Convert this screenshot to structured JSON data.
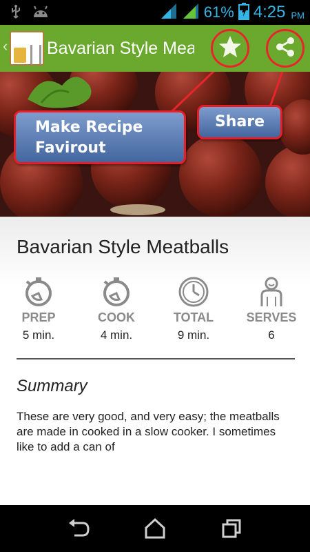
{
  "status_bar": {
    "battery_percent": "61%",
    "time": "4:25",
    "ampm": "PM",
    "icons": [
      "usb-icon",
      "android-icon",
      "signal-icon",
      "signal-icon",
      "battery-icon"
    ]
  },
  "action_bar": {
    "title": "Bavarian Style Meatballs",
    "favourite_icon": "star-icon",
    "share_icon": "share-icon"
  },
  "callouts": {
    "favourite_line1": "Make Recipe",
    "favourite_line2": "Favirout",
    "share": "Share"
  },
  "recipe": {
    "title": "Bavarian Style Meatballs",
    "stats": [
      {
        "label": "PREP",
        "value": "5 min.",
        "icon": "timer-icon"
      },
      {
        "label": "COOK",
        "value": "4 min.",
        "icon": "timer-icon"
      },
      {
        "label": "TOTAL",
        "value": "9 min.",
        "icon": "clock-icon"
      },
      {
        "label": "SERVES",
        "value": "6",
        "icon": "person-icon"
      }
    ],
    "summary_heading": "Summary",
    "summary_text": "These are very good, and very easy; the meatballs are made in cooked in a slow cooker. I sometimes like to add a can of"
  },
  "nav_bar": {
    "icons": [
      "back-icon",
      "home-icon",
      "recent-apps-icon"
    ]
  },
  "colors": {
    "action_bar": "#6aa92e",
    "status_accent": "#33b5e5",
    "annotation_red": "#e8252b",
    "callout_blue": "#5d7fb8"
  }
}
